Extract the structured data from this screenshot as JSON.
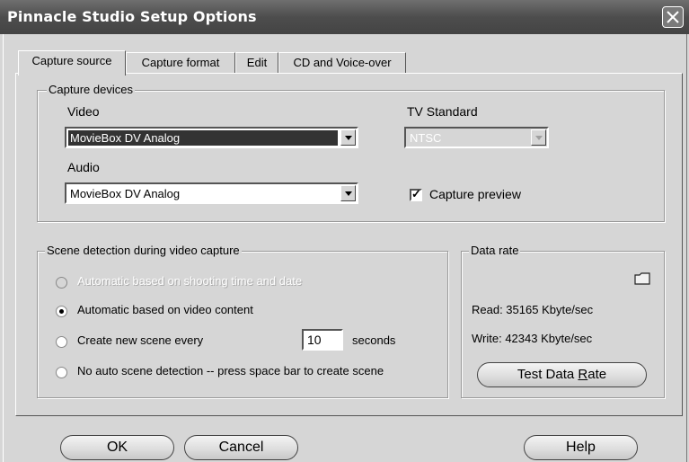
{
  "window": {
    "title": "Pinnacle Studio Setup Options"
  },
  "tabs": [
    {
      "label": "Capture source"
    },
    {
      "label": "Capture format"
    },
    {
      "label": "Edit"
    },
    {
      "label": "CD and Voice-over"
    }
  ],
  "capture_devices": {
    "group_label": "Capture devices",
    "video_label": "Video",
    "video_value": "MovieBox DV Analog",
    "audio_label": "Audio",
    "audio_value": "MovieBox DV Analog",
    "tv_standard_label": "TV Standard",
    "tv_standard_value": "NTSC",
    "capture_preview_label": "Capture preview",
    "capture_preview_checked": true
  },
  "scene_detection": {
    "group_label": "Scene detection during video capture",
    "options": [
      {
        "label": "Automatic based on shooting time and date",
        "selected": false,
        "enabled": false
      },
      {
        "label": "Automatic based on video content",
        "selected": true,
        "enabled": true
      },
      {
        "label": "Create new scene every",
        "selected": false,
        "enabled": true
      },
      {
        "label": "No auto scene detection -- press space bar to create scene",
        "selected": false,
        "enabled": true
      }
    ],
    "seconds_value": "10",
    "seconds_unit": "seconds"
  },
  "data_rate": {
    "group_label": "Data rate",
    "read": "Read: 35165 Kbyte/sec",
    "write": "Write: 42343 Kbyte/sec",
    "test_button_prefix": "Test Data ",
    "test_button_accel": "R",
    "test_button_suffix": "ate"
  },
  "footer": {
    "ok_label": "OK",
    "cancel_label": "Cancel",
    "help_label": "Help"
  }
}
